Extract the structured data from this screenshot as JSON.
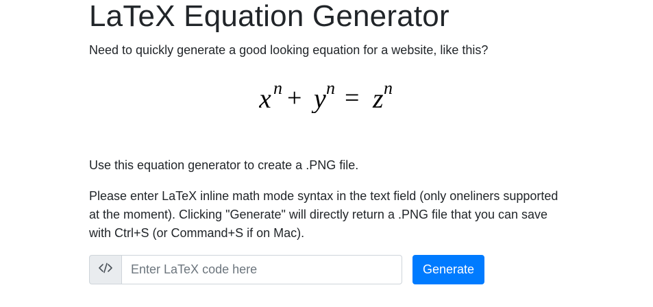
{
  "page": {
    "title": "LaTeX Equation Generator",
    "lead": "Need to quickly generate a good looking equation for a website, like this?",
    "intro": "Use this equation generator to create a .PNG file.",
    "instructions": "Please enter LaTeX inline math mode syntax in the text field (only oneliners supported at the moment). Clicking \"Generate\" will directly return a .PNG file that you can save with Ctrl+S (or Command+S if on Mac)."
  },
  "example_equation": {
    "base1": "x",
    "exp1": "n",
    "plus": "+",
    "base2": "y",
    "exp2": "n",
    "equals": "=",
    "base3": "z",
    "exp3": "n"
  },
  "form": {
    "prepend_icon": "code-icon",
    "input_placeholder": "Enter LaTeX code here",
    "input_value": "",
    "button_label": "Generate"
  },
  "colors": {
    "primary": "#007bff",
    "text": "#212529",
    "prepend_bg": "#e9ecef",
    "border": "#ced4da"
  }
}
